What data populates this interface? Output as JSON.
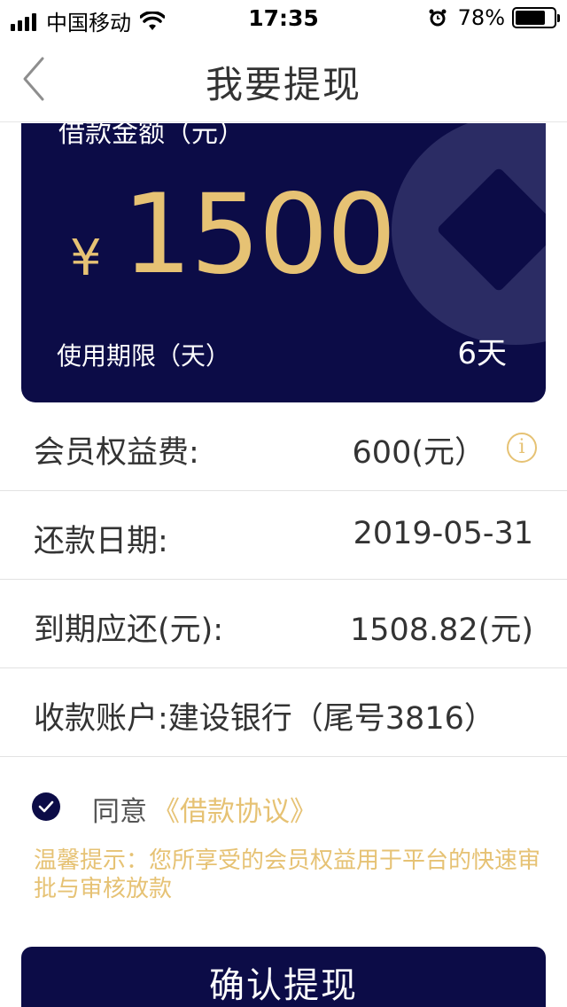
{
  "status_bar": {
    "carrier": "中国移动",
    "time": "17:35",
    "battery": "78%",
    "battery_level": 0.78
  },
  "nav": {
    "title": "我要提现",
    "back_icon": "chevron-left-icon"
  },
  "card": {
    "label_top": "借款金额（元）",
    "currency": "¥",
    "amount": "1500",
    "period_label": "使用期限（天）",
    "period_value": "6天",
    "colors": {
      "background": "#0c0c47",
      "accent": "#e6c274",
      "coin": "#2b2c64"
    }
  },
  "rows": [
    {
      "label": "会员权益费:",
      "value": "600(元）",
      "info_icon": "info-icon"
    },
    {
      "label": "还款日期:",
      "value": "2019-05-31"
    },
    {
      "label": "到期应还(元):",
      "value": "1508.82(元)"
    },
    {
      "label": "收款账户:建设银行（尾号3816）"
    }
  ],
  "agreement": {
    "checked": true,
    "text": "同意",
    "link": "《借款协议》"
  },
  "tip": "温馨提示：您所享受的会员权益用于平台的快速审批与审核放款",
  "confirm_button": "确认提现"
}
